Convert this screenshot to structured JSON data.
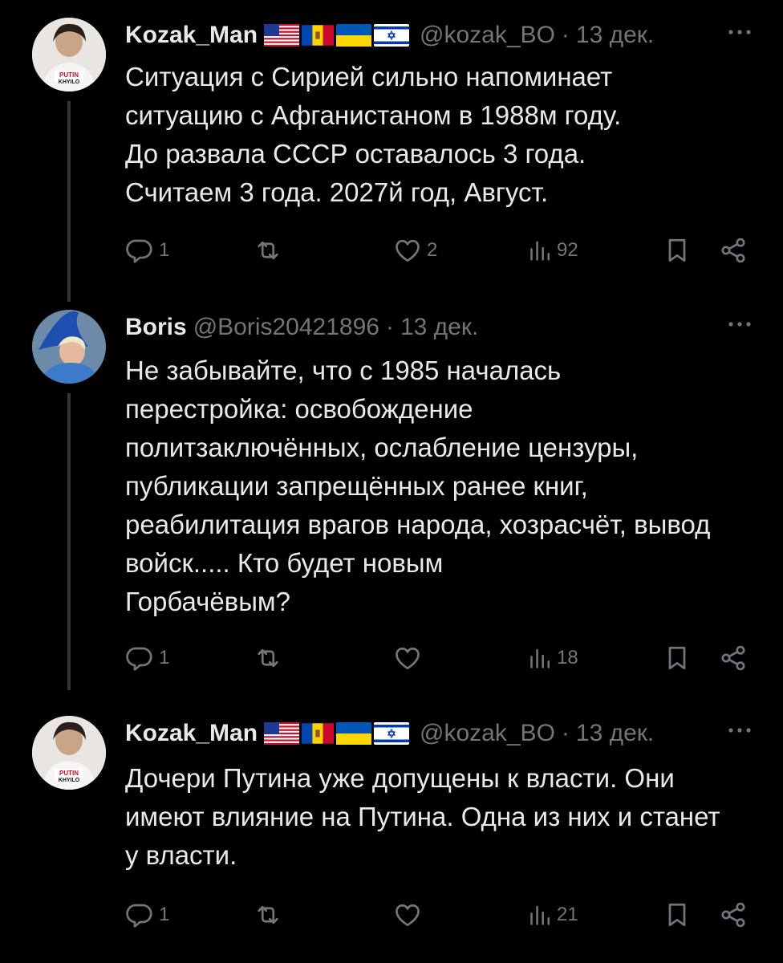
{
  "colors": {
    "background": "#000000",
    "text": "#e7e9ea",
    "secondary": "#71767b",
    "thread_line": "#333639"
  },
  "tweets": [
    {
      "author": {
        "name": "Kozak_Man",
        "handle": "@kozak_BO",
        "date": "13 дек.",
        "flags": [
          "us-flag-icon",
          "moldova-flag-icon",
          "ukraine-flag-icon",
          "israel-flag-icon"
        ]
      },
      "text": "Ситуация с Сирией сильно напоминает\nситуацию с Афганистаном в 1988м году.\nДо развала СССР оставалось 3 года.\nСчитаем 3 года. 2027й год, Август.",
      "stats": {
        "replies": "1",
        "reposts": "",
        "likes": "2",
        "views": "92"
      }
    },
    {
      "author": {
        "name": "Boris",
        "handle": "@Boris20421896",
        "date": "13 дек.",
        "flags": []
      },
      "text": "Не забывайте, что с 1985 началась\nперестройка: освобождение\nполитзаключённых, ослабление цензуры,\nпубликации запрещённых ранее книг,\nреабилитация врагов народа, хозрасчёт, вывод\nвойск.....                                   Кто будет новым\nГорбачёвым?",
      "stats": {
        "replies": "1",
        "reposts": "",
        "likes": "",
        "views": "18"
      }
    },
    {
      "author": {
        "name": "Kozak_Man",
        "handle": "@kozak_BO",
        "date": "13 дек.",
        "flags": [
          "us-flag-icon",
          "moldova-flag-icon",
          "ukraine-flag-icon",
          "israel-flag-icon"
        ]
      },
      "text": "Дочери Путина уже допущены к власти. Они\nимеют влияние на Путина. Одна из них и станет\nу власти.",
      "stats": {
        "replies": "1",
        "reposts": "",
        "likes": "",
        "views": "21"
      }
    }
  ],
  "icons": {
    "reply": "reply-icon",
    "repost": "repost-icon",
    "like": "like-icon",
    "views": "views-icon",
    "bookmark": "bookmark-icon",
    "share": "share-icon",
    "more": "more-icon"
  }
}
